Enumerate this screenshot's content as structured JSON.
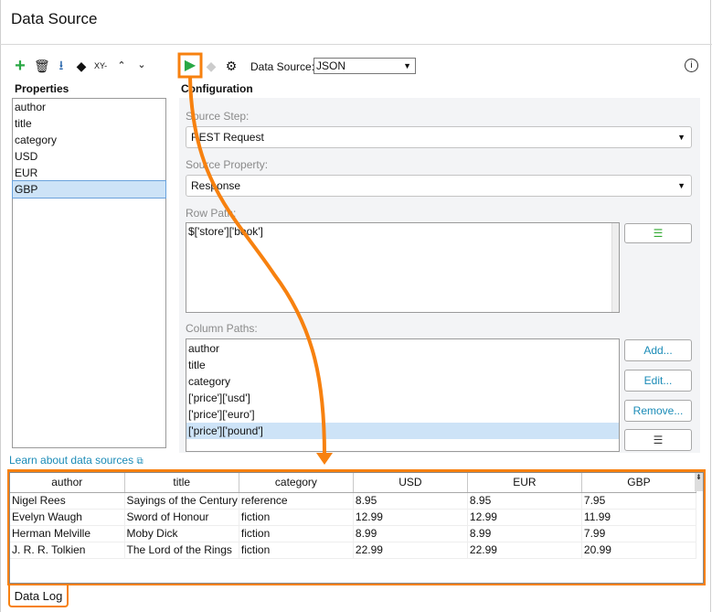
{
  "title": "Data Source",
  "left_toolbar": {
    "icons": [
      "add-icon",
      "delete-icon",
      "download-icon",
      "eraser-icon",
      "xy-icon",
      "chevron-up-icon",
      "chevron-down-icon"
    ],
    "xy_label": "XY-"
  },
  "properties": {
    "heading": "Properties",
    "items": [
      "author",
      "title",
      "category",
      "USD",
      "EUR",
      "GBP"
    ],
    "selected": "GBP"
  },
  "right_toolbar": {
    "data_source_label": "Data Source:",
    "data_source_value": "JSON"
  },
  "config": {
    "heading": "Configuration",
    "source_step_label": "Source Step:",
    "source_step_value": "REST Request",
    "source_property_label": "Source Property:",
    "source_property_value": "Response",
    "row_path_label": "Row Path:",
    "row_path_value": "$['store']['book']",
    "column_paths_label": "Column Paths:",
    "column_paths": [
      "author",
      "title",
      "category",
      "['price']['usd']",
      "['price']['euro']",
      "['price']['pound']"
    ],
    "column_selected": "['price']['pound']",
    "add_label": "Add...",
    "edit_label": "Edit...",
    "remove_label": "Remove..."
  },
  "learn_link": "Learn about data sources",
  "table": {
    "headers": [
      "author",
      "title",
      "category",
      "USD",
      "EUR",
      "GBP"
    ],
    "rows": [
      [
        "Nigel Rees",
        "Sayings of the Century",
        "reference",
        "8.95",
        "8.95",
        "7.95"
      ],
      [
        "Evelyn Waugh",
        "Sword of Honour",
        "fiction",
        "12.99",
        "12.99",
        "11.99"
      ],
      [
        "Herman Melville",
        "Moby Dick",
        "fiction",
        "8.99",
        "8.99",
        "7.99"
      ],
      [
        "J. R. R. Tolkien",
        "The Lord of the Rings",
        "fiction",
        "22.99",
        "22.99",
        "20.99"
      ]
    ]
  },
  "bottom_tab": "Data Log",
  "colors": {
    "accent": "#f7810f",
    "link": "#1a8bb7",
    "run": "#2aa845"
  }
}
